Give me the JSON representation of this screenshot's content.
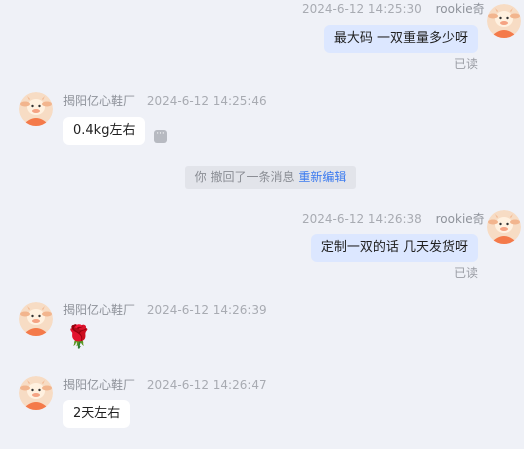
{
  "messages": [
    {
      "sender": "rookie奇",
      "time": "2024-6-12 14:25:30",
      "text": "最大码  一双重量多少呀",
      "status": "已读"
    },
    {
      "sender": "揭阳亿心鞋厂",
      "time": "2024-6-12 14:25:46",
      "text": "0.4kg左右"
    },
    {
      "sender": "rookie奇",
      "time": "2024-6-12 14:26:38",
      "text": "定制一双的话  几天发货呀",
      "status": "已读"
    },
    {
      "sender": "揭阳亿心鞋厂",
      "time": "2024-6-12 14:26:39",
      "emoji": "🌹"
    },
    {
      "sender": "揭阳亿心鞋厂",
      "time": "2024-6-12 14:26:47",
      "text": "2天左右"
    }
  ],
  "recall_notice": {
    "text": "你 撤回了一条消息",
    "action": "重新编辑"
  },
  "colors": {
    "incoming_bubble": "#ffffff",
    "outgoing_bubble": "#dce7ff",
    "background": "#eff1f7",
    "link": "#3c7bf0"
  },
  "icons": {
    "avatar": "cartoon-cow-avatar-icon",
    "more": "more-options-icon"
  }
}
